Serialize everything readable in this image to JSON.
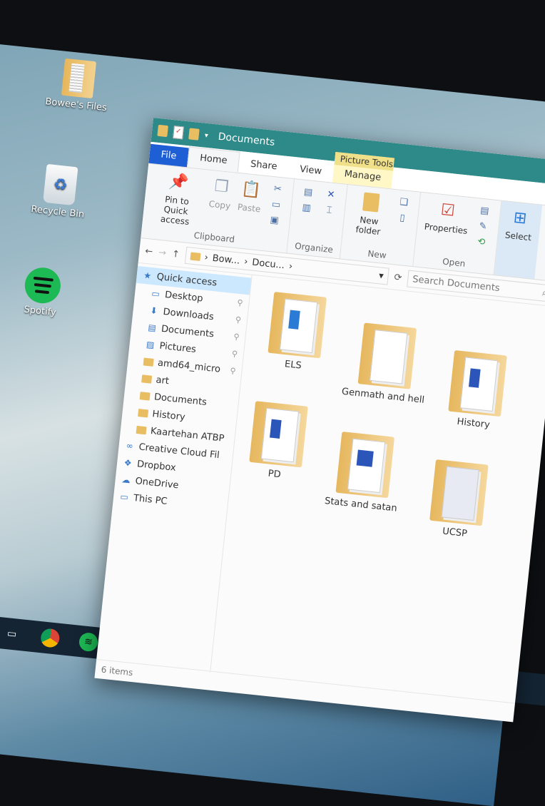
{
  "desktop": {
    "icons": [
      {
        "label": "Bowee's Files",
        "icon": "folder-icon"
      },
      {
        "label": "Recycle Bin",
        "icon": "recycle-bin-icon"
      },
      {
        "label": "Spotify",
        "icon": "spotify-icon"
      }
    ]
  },
  "window": {
    "title": "Documents",
    "tabs": {
      "file": "File",
      "home": "Home",
      "share": "Share",
      "view": "View",
      "context_group": "Picture Tools",
      "manage": "Manage"
    },
    "ribbon": {
      "clipboard": {
        "pin_label": "Pin to Quick access",
        "copy_label": "Copy",
        "paste_label": "Paste",
        "group_label": "Clipboard"
      },
      "organize": {
        "group_label": "Organize"
      },
      "new": {
        "new_folder_label": "New folder",
        "group_label": "New"
      },
      "open": {
        "properties_label": "Properties",
        "group_label": "Open"
      },
      "select": {
        "select_label": "Select"
      }
    },
    "address": {
      "segments": [
        "Bow...",
        "Docu..."
      ],
      "search_placeholder": "Search Documents"
    },
    "sidebar": {
      "items": [
        {
          "label": "Quick access",
          "icon": "star-icon",
          "pinned": false,
          "indent": false,
          "selected": true
        },
        {
          "label": "Desktop",
          "icon": "desktop-icon",
          "pinned": true,
          "indent": true,
          "selected": false
        },
        {
          "label": "Downloads",
          "icon": "download-icon",
          "pinned": true,
          "indent": true,
          "selected": false
        },
        {
          "label": "Documents",
          "icon": "document-icon",
          "pinned": true,
          "indent": true,
          "selected": false
        },
        {
          "label": "Pictures",
          "icon": "picture-icon",
          "pinned": true,
          "indent": true,
          "selected": false
        },
        {
          "label": "amd64_micro",
          "icon": "folder-icon",
          "pinned": true,
          "indent": true,
          "selected": false
        },
        {
          "label": "art",
          "icon": "folder-icon",
          "pinned": false,
          "indent": true,
          "selected": false
        },
        {
          "label": "Documents",
          "icon": "folder-icon",
          "pinned": false,
          "indent": true,
          "selected": false
        },
        {
          "label": "History",
          "icon": "folder-icon",
          "pinned": false,
          "indent": true,
          "selected": false
        },
        {
          "label": "Kaartehan ATBP",
          "icon": "folder-icon",
          "pinned": false,
          "indent": true,
          "selected": false
        },
        {
          "label": "Creative Cloud Fil",
          "icon": "creative-cloud-icon",
          "pinned": false,
          "indent": false,
          "selected": false
        },
        {
          "label": "Dropbox",
          "icon": "dropbox-icon",
          "pinned": false,
          "indent": false,
          "selected": false
        },
        {
          "label": "OneDrive",
          "icon": "onedrive-icon",
          "pinned": false,
          "indent": false,
          "selected": false
        },
        {
          "label": "This PC",
          "icon": "computer-icon",
          "pinned": false,
          "indent": false,
          "selected": false
        }
      ]
    },
    "files": [
      {
        "name": "ELS"
      },
      {
        "name": "Genmath and hell"
      },
      {
        "name": "History"
      },
      {
        "name": "PD"
      },
      {
        "name": "Stats and satan"
      },
      {
        "name": "UCSP"
      }
    ],
    "status": "6 items"
  }
}
